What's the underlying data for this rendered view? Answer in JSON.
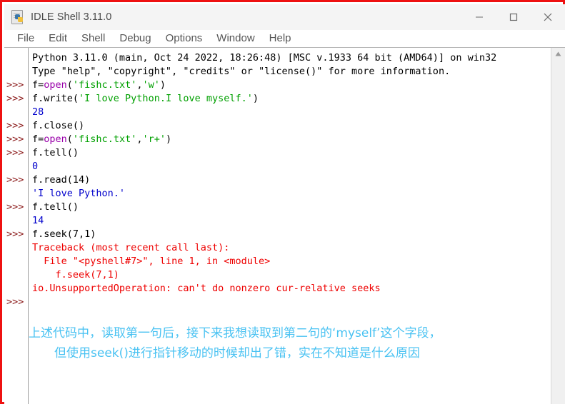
{
  "window": {
    "title": "IDLE Shell 3.11.0",
    "icon": "python-document-icon",
    "accent_border_color": "#ee1111",
    "controls": {
      "minimize": "minimize-icon",
      "maximize": "maximize-icon",
      "close": "close-icon"
    }
  },
  "menu": {
    "items": [
      {
        "label": "File"
      },
      {
        "label": "Edit"
      },
      {
        "label": "Shell"
      },
      {
        "label": "Debug"
      },
      {
        "label": "Options"
      },
      {
        "label": "Window"
      },
      {
        "label": "Help"
      }
    ]
  },
  "scrollbar": {
    "up_arrow": "scroll-up-arrow-icon"
  },
  "shell": {
    "prompt": ">>>",
    "colors": {
      "keyword": "#9900aa",
      "string": "#00a000",
      "output": "#0000cc",
      "error": "#ee0000",
      "prompt": "#8b1a1a",
      "annotation": "#49c2f2"
    },
    "lines": [
      {
        "prompt": false,
        "segments": [
          {
            "text": "Python 3.11.0 (main, Oct 24 2022, 18:26:48) [MSC v.1933 64 bit (AMD64)] on win32",
            "type": "plain"
          }
        ]
      },
      {
        "prompt": false,
        "segments": [
          {
            "text": "Type \"help\", \"copyright\", \"credits\" or \"license()\" for more information.",
            "type": "plain"
          }
        ]
      },
      {
        "prompt": true,
        "segments": [
          {
            "text": "f=",
            "type": "plain"
          },
          {
            "text": "open",
            "type": "keyword"
          },
          {
            "text": "(",
            "type": "plain"
          },
          {
            "text": "'fishc.txt'",
            "type": "string"
          },
          {
            "text": ",",
            "type": "plain"
          },
          {
            "text": "'w'",
            "type": "string"
          },
          {
            "text": ")",
            "type": "plain"
          }
        ]
      },
      {
        "prompt": true,
        "segments": [
          {
            "text": "f.write(",
            "type": "plain"
          },
          {
            "text": "'I love Python.I love myself.'",
            "type": "string"
          },
          {
            "text": ")",
            "type": "plain"
          }
        ]
      },
      {
        "prompt": false,
        "segments": [
          {
            "text": "28",
            "type": "output"
          }
        ]
      },
      {
        "prompt": true,
        "segments": [
          {
            "text": "f.close()",
            "type": "plain"
          }
        ]
      },
      {
        "prompt": true,
        "segments": [
          {
            "text": "f=",
            "type": "plain"
          },
          {
            "text": "open",
            "type": "keyword"
          },
          {
            "text": "(",
            "type": "plain"
          },
          {
            "text": "'fishc.txt'",
            "type": "string"
          },
          {
            "text": ",",
            "type": "plain"
          },
          {
            "text": "'r+'",
            "type": "string"
          },
          {
            "text": ")",
            "type": "plain"
          }
        ]
      },
      {
        "prompt": true,
        "segments": [
          {
            "text": "f.tell()",
            "type": "plain"
          }
        ]
      },
      {
        "prompt": false,
        "segments": [
          {
            "text": "0",
            "type": "output"
          }
        ]
      },
      {
        "prompt": true,
        "segments": [
          {
            "text": "f.read(14)",
            "type": "plain"
          }
        ]
      },
      {
        "prompt": false,
        "segments": [
          {
            "text": "'I love Python.'",
            "type": "output"
          }
        ]
      },
      {
        "prompt": true,
        "segments": [
          {
            "text": "f.tell()",
            "type": "plain"
          }
        ]
      },
      {
        "prompt": false,
        "segments": [
          {
            "text": "14",
            "type": "output"
          }
        ]
      },
      {
        "prompt": true,
        "segments": [
          {
            "text": "f.seek(7,1)",
            "type": "plain"
          }
        ]
      },
      {
        "prompt": false,
        "segments": [
          {
            "text": "Traceback (most recent call last):",
            "type": "error"
          }
        ]
      },
      {
        "prompt": false,
        "segments": [
          {
            "text": "  File \"<pyshell#7>\", line 1, in <module>",
            "type": "error"
          }
        ]
      },
      {
        "prompt": false,
        "segments": [
          {
            "text": "    f.seek(7,1)",
            "type": "error"
          }
        ]
      },
      {
        "prompt": false,
        "segments": [
          {
            "text": "io.UnsupportedOperation: can't do nonzero cur-relative seeks",
            "type": "error"
          }
        ]
      },
      {
        "prompt": true,
        "segments": []
      }
    ],
    "annotation": {
      "line1": "上述代码中，读取第一句后，接下来我想读取到第二句的‘myself’这个字段，",
      "line2": "但使用seek()进行指针移动的时候却出了错，实在不知道是什么原因"
    }
  }
}
